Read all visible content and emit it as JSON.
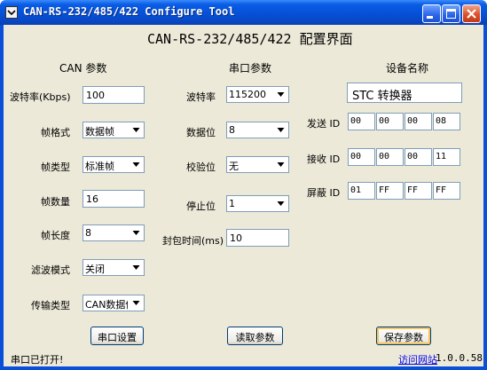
{
  "window": {
    "title": "CAN-RS-232/485/422 Configure Tool"
  },
  "header": {
    "title": "CAN-RS-232/485/422 配置界面"
  },
  "can": {
    "heading": "CAN 参数",
    "baud_label": "波特率(Kbps)",
    "baud_value": "100",
    "frame_format_label": "帧格式",
    "frame_format_value": "数据帧",
    "frame_type_label": "帧类型",
    "frame_type_value": "标准帧",
    "frame_count_label": "帧数量",
    "frame_count_value": "16",
    "frame_length_label": "帧长度",
    "frame_length_value": "8",
    "filter_mode_label": "滤波模式",
    "filter_mode_value": "关闭",
    "transfer_type_label": "传输类型",
    "transfer_type_value": "CAN数据传"
  },
  "serial": {
    "heading": "串口参数",
    "baud_label": "波特率",
    "baud_value": "115200",
    "data_bits_label": "数据位",
    "data_bits_value": "8",
    "parity_label": "校验位",
    "parity_value": "无",
    "stop_bits_label": "停止位",
    "stop_bits_value": "1",
    "packet_time_label": "封包时间(ms)",
    "packet_time_value": "10"
  },
  "device": {
    "heading": "设备名称",
    "name_value": "STC 转换器",
    "send_id_label": "发送 ID",
    "send_id": [
      "00",
      "00",
      "00",
      "08"
    ],
    "recv_id_label": "接收 ID",
    "recv_id": [
      "00",
      "00",
      "00",
      "11"
    ],
    "mask_id_label": "屏蔽 ID",
    "mask_id": [
      "01",
      "FF",
      "FF",
      "FF"
    ]
  },
  "buttons": {
    "serial_settings": "串口设置",
    "read_params": "读取参数",
    "save_params": "保存参数"
  },
  "status": {
    "left": "串口已打开!",
    "link": "访问网站",
    "version": "1.0.0.58"
  }
}
